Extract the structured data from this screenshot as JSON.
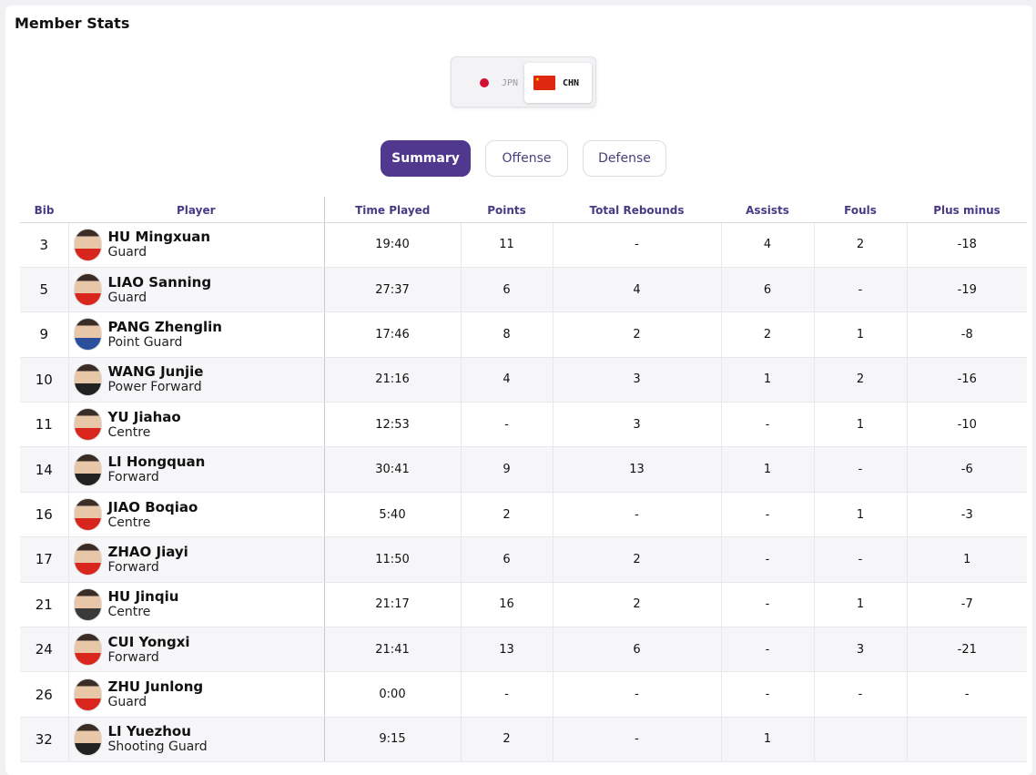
{
  "header": {
    "title": "Member Stats"
  },
  "teams": [
    {
      "code": "JPN",
      "flag_icon": "japan-flag-icon",
      "selected": false
    },
    {
      "code": "CHN",
      "flag_icon": "china-flag-icon",
      "selected": true
    }
  ],
  "tabs": [
    {
      "label": "Summary",
      "active": true
    },
    {
      "label": "Offense",
      "active": false
    },
    {
      "label": "Defense",
      "active": false
    }
  ],
  "table": {
    "columns": [
      "Bib",
      "Player",
      "Time Played",
      "Points",
      "Total Rebounds",
      "Assists",
      "Fouls",
      "Plus minus"
    ],
    "rows": [
      {
        "bib": "3",
        "name": "HU Mingxuan",
        "position": "Guard",
        "time": "19:40",
        "points": "11",
        "rebounds": "-",
        "assists": "4",
        "fouls": "2",
        "plus_minus": "-18"
      },
      {
        "bib": "5",
        "name": "LIAO Sanning",
        "position": "Guard",
        "time": "27:37",
        "points": "6",
        "rebounds": "4",
        "assists": "6",
        "fouls": "-",
        "plus_minus": "-19"
      },
      {
        "bib": "9",
        "name": "PANG Zhenglin",
        "position": "Point Guard",
        "time": "17:46",
        "points": "8",
        "rebounds": "2",
        "assists": "2",
        "fouls": "1",
        "plus_minus": "-8"
      },
      {
        "bib": "10",
        "name": "WANG Junjie",
        "position": "Power Forward",
        "time": "21:16",
        "points": "4",
        "rebounds": "3",
        "assists": "1",
        "fouls": "2",
        "plus_minus": "-16"
      },
      {
        "bib": "11",
        "name": "YU Jiahao",
        "position": "Centre",
        "time": "12:53",
        "points": "-",
        "rebounds": "3",
        "assists": "-",
        "fouls": "1",
        "plus_minus": "-10"
      },
      {
        "bib": "14",
        "name": "LI Hongquan",
        "position": "Forward",
        "time": "30:41",
        "points": "9",
        "rebounds": "13",
        "assists": "1",
        "fouls": "-",
        "plus_minus": "-6"
      },
      {
        "bib": "16",
        "name": "JIAO Boqiao",
        "position": "Centre",
        "time": "5:40",
        "points": "2",
        "rebounds": "-",
        "assists": "-",
        "fouls": "1",
        "plus_minus": "-3"
      },
      {
        "bib": "17",
        "name": "ZHAO Jiayi",
        "position": "Forward",
        "time": "11:50",
        "points": "6",
        "rebounds": "2",
        "assists": "-",
        "fouls": "-",
        "plus_minus": "1"
      },
      {
        "bib": "21",
        "name": "HU Jinqiu",
        "position": "Centre",
        "time": "21:17",
        "points": "16",
        "rebounds": "2",
        "assists": "-",
        "fouls": "1",
        "plus_minus": "-7"
      },
      {
        "bib": "24",
        "name": "CUI Yongxi",
        "position": "Forward",
        "time": "21:41",
        "points": "13",
        "rebounds": "6",
        "assists": "-",
        "fouls": "3",
        "plus_minus": "-21"
      },
      {
        "bib": "26",
        "name": "ZHU Junlong",
        "position": "Guard",
        "time": "0:00",
        "points": "-",
        "rebounds": "-",
        "assists": "-",
        "fouls": "-",
        "plus_minus": "-"
      },
      {
        "bib": "32",
        "name": "LI Yuezhou",
        "position": "Shooting Guard",
        "time": "9:15",
        "points": "2",
        "rebounds": "-",
        "assists": "1",
        "fouls": "",
        "plus_minus": ""
      }
    ]
  },
  "colors": {
    "accent": "#51388f",
    "header_text": "#4a3a86",
    "row_alt": "#f6f6f8"
  }
}
